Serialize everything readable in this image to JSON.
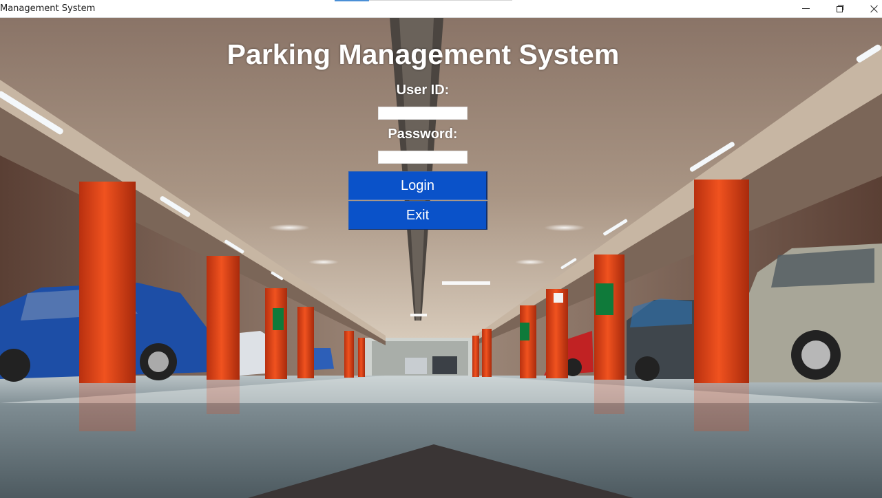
{
  "window": {
    "title": "Management System",
    "controls": {
      "minimize": "minimize-icon",
      "restore": "restore-icon",
      "close": "close-icon"
    }
  },
  "login": {
    "heading": "Parking Management System",
    "user_id_label": "User ID:",
    "user_id_value": "",
    "password_label": "Password:",
    "password_value": "",
    "login_button": "Login",
    "exit_button": "Exit"
  },
  "colors": {
    "button_blue": "#0a52c9",
    "pillar_orange": "#e4461c",
    "heading_text": "#ffffff"
  }
}
